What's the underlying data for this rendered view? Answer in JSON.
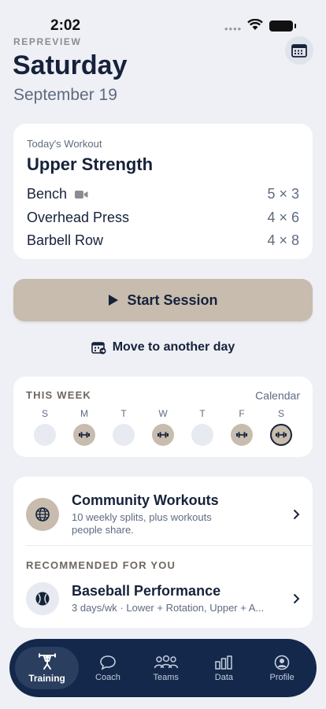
{
  "status_bar": {
    "time": "2:02"
  },
  "header": {
    "eyebrow": "REPREVIEW",
    "day": "Saturday",
    "date": "September 19"
  },
  "workout": {
    "label": "Today's Workout",
    "title": "Upper Strength",
    "exercises": [
      {
        "name": "Bench",
        "sets": "5 × 3",
        "has_video": true
      },
      {
        "name": "Overhead Press",
        "sets": "4 × 6"
      },
      {
        "name": "Barbell Row",
        "sets": "4 × 8"
      }
    ]
  },
  "actions": {
    "start_label": "Start Session",
    "move_label": "Move to another day"
  },
  "week": {
    "title": "THIS WEEK",
    "calendar_link": "Calendar",
    "days": [
      {
        "letter": "S",
        "state": "rest"
      },
      {
        "letter": "M",
        "state": "workout"
      },
      {
        "letter": "T",
        "state": "rest"
      },
      {
        "letter": "W",
        "state": "workout"
      },
      {
        "letter": "T",
        "state": "rest"
      },
      {
        "letter": "F",
        "state": "workout"
      },
      {
        "letter": "S",
        "state": "today"
      }
    ]
  },
  "community": {
    "title": "Community Workouts",
    "desc": "10 weekly splits, plus workouts people share.",
    "rec_label": "RECOMMENDED FOR YOU",
    "rec_title": "Baseball Performance",
    "rec_desc": "3 days/wk · Lower + Rotation, Upper + A..."
  },
  "tabs": [
    {
      "label": "Training",
      "icon": "weightlifter-icon",
      "active": true
    },
    {
      "label": "Coach",
      "icon": "chat-bubble-icon"
    },
    {
      "label": "Teams",
      "icon": "people-group-icon"
    },
    {
      "label": "Data",
      "icon": "bar-chart-icon"
    },
    {
      "label": "Profile",
      "icon": "user-circle-icon"
    }
  ],
  "colors": {
    "background": "#eef0f5",
    "navy": "#16223a",
    "accent_tan": "#c7bcae",
    "tab_bar": "#13284a"
  }
}
